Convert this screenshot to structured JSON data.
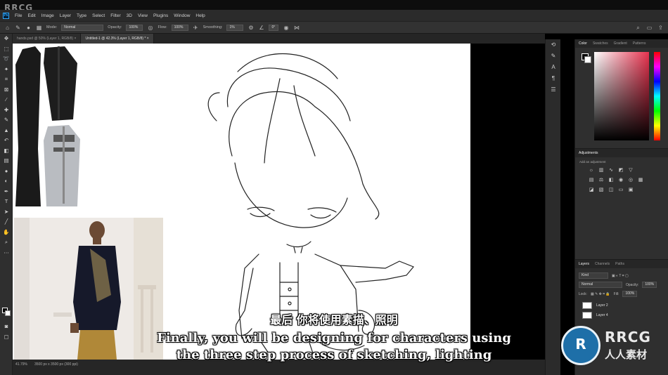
{
  "watermark_top": "RRCG",
  "menu": [
    "File",
    "Edit",
    "Image",
    "Layer",
    "Type",
    "Select",
    "Filter",
    "3D",
    "View",
    "Plugins",
    "Window",
    "Help"
  ],
  "options": {
    "mode_label": "Mode:",
    "mode_value": "Normal",
    "opacity_label": "Opacity:",
    "opacity_value": "100%",
    "flow_label": "Flow:",
    "flow_value": "100%",
    "smoothing_label": "Smoothing:",
    "smoothing_value": "1%",
    "angle_value": "0°"
  },
  "tabs": [
    {
      "label": "hands.psd @ 50% (Layer 1, RGB/8)",
      "close": "×"
    },
    {
      "label": "Untitled-1 @ 42.3% (Layer 1, RGB/8) *",
      "close": "×"
    }
  ],
  "status": {
    "zoom": "41.79%",
    "doc_size": "3500 px x 3500 px (300 ppi)"
  },
  "color_panel": {
    "tabs": [
      "Color",
      "Swatches",
      "Gradient",
      "Patterns"
    ]
  },
  "adjustments": {
    "title": "Adjustments",
    "caption": "Add an adjustment"
  },
  "layers_panel": {
    "tabs": [
      "Layers",
      "Channels",
      "Paths"
    ],
    "filter_label": "Kind",
    "blend_value": "Normal",
    "opacity_label": "Opacity:",
    "opacity_value": "100%",
    "lock_label": "Lock:",
    "fill_label": "Fill:",
    "fill_value": "100%",
    "layers": [
      "Layer 2",
      "Layer 4"
    ]
  },
  "subtitles": {
    "cn": "最后 你将使用素描、照明",
    "en_line1": "Finally, you will be designing for characters using",
    "en_line2": "the three step process of sketching, lighting"
  },
  "badge": {
    "mark": "R",
    "word": "RRCG",
    "cn": "人人素材",
    "circle_color": "#1e6fa8"
  },
  "colors": {
    "accent": "#31a8ff",
    "panel_bg": "#2f2f2f",
    "workspace_bg": "#000000"
  }
}
